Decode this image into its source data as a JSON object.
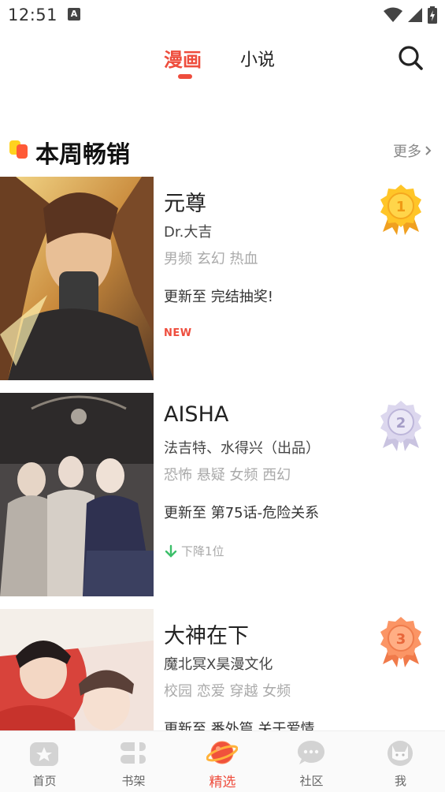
{
  "status_bar": {
    "time": "12:51",
    "notification_icon": "A"
  },
  "top_tabs": {
    "comic": "漫画",
    "novel": "小说",
    "active": "comic",
    "accent_color": "#ee4d3d"
  },
  "section": {
    "title": "本周畅销",
    "more": "更多"
  },
  "items": [
    {
      "title": "元尊",
      "author": "Dr.大吉",
      "tags": "男频 玄幻 热血",
      "update": "更新至 完结抽奖!",
      "badge": "NEW",
      "rank": "1",
      "medal_color": "gold"
    },
    {
      "title": "AISHA",
      "author": "法吉特、水得兴（出品）",
      "tags": "恐怖 悬疑 女频 西幻",
      "update": "更新至 第75话-危险关系",
      "trend": "下降1位",
      "rank": "2",
      "medal_color": "silver"
    },
    {
      "title": "大神在下",
      "author": "魔北冥X昊漫文化",
      "tags": "校园 恋爱 穿越 女频",
      "update": "更新至 番外篇 关于爱情",
      "rank": "3",
      "medal_color": "bronze"
    }
  ],
  "bottom_nav": {
    "items": [
      {
        "label": "首页",
        "icon": "home-star-icon"
      },
      {
        "label": "书架",
        "icon": "bookshelf-icon"
      },
      {
        "label": "精选",
        "icon": "planet-icon"
      },
      {
        "label": "社区",
        "icon": "chat-bubble-icon"
      },
      {
        "label": "我",
        "icon": "profile-cat-icon"
      }
    ],
    "active_index": 2
  }
}
